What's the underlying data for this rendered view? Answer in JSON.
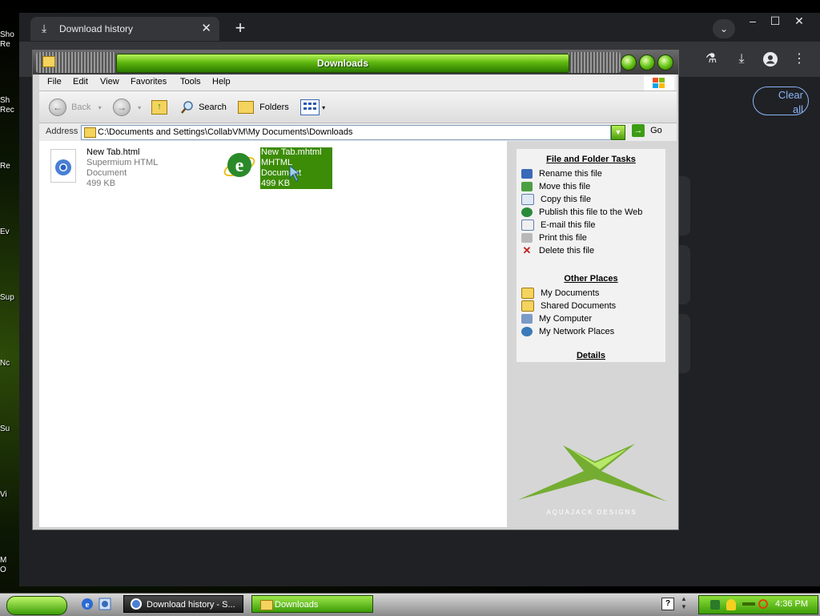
{
  "desktop": {
    "labels": [
      "Sho",
      "Re",
      "Sh",
      "Rec",
      "Re",
      "Ev",
      "Sup",
      "Nc",
      "Su",
      "Vi",
      "M",
      "O"
    ]
  },
  "chrome": {
    "tab_title": "Download history",
    "tab_close": "✕",
    "new_tab": "+",
    "clear_all_line1": "Clear",
    "clear_all_line2": "all",
    "min": "–",
    "max": "☐",
    "close": "✕"
  },
  "explorer": {
    "title": "Downloads",
    "menu": [
      "File",
      "Edit",
      "View",
      "Favorites",
      "Tools",
      "Help"
    ],
    "toolbar": {
      "back": "Back",
      "search": "Search",
      "folders": "Folders"
    },
    "address_label": "Address",
    "address_value": "C:\\Documents and Settings\\CollabVM\\My Documents\\Downloads",
    "go": "Go",
    "files": [
      {
        "name": "New Tab.html",
        "type": "Supermium HTML Document",
        "size": "499 KB"
      },
      {
        "name": "New Tab.mhtml",
        "type": "MHTML Document",
        "size": "499 KB"
      }
    ],
    "file_tasks": {
      "heading": "File and Folder Tasks",
      "items": [
        "Rename this file",
        "Move this file",
        "Copy this file",
        "Publish this file to the Web",
        "E-mail this file",
        "Print this file",
        "Delete this file"
      ]
    },
    "other_places": {
      "heading": "Other Places",
      "items": [
        "My Documents",
        "Shared Documents",
        "My Computer",
        "My Network Places"
      ]
    },
    "details": {
      "heading": "Details"
    },
    "logo_text": "AQUAJACK  DESIGNS"
  },
  "taskbar": {
    "apps": [
      "Download history - S...",
      "Downloads"
    ],
    "clock": "4:36 PM"
  }
}
